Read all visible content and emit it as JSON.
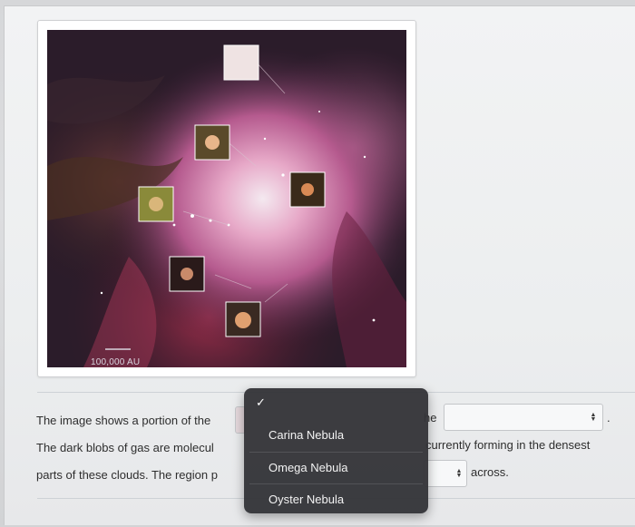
{
  "figure": {
    "scale_bar_label": "100,000 AU"
  },
  "question": {
    "line1_start": "The image shows a portion of the",
    "line1_end": "he",
    "line1_period": ".",
    "line2_start": "The dark blobs of gas are molecul",
    "line2_end": "currently forming in the densest",
    "line3_start": "parts of these clouds. The region p",
    "line3_end": "across."
  },
  "dropdown": {
    "selected_mark": "✓",
    "options": [
      "Carina Nebula",
      "Omega Nebula",
      "Oyster Nebula"
    ]
  },
  "icons": {
    "select_arrows": "up-down-arrows-icon",
    "check": "checkmark-icon"
  },
  "colors": {
    "dropdown_bg": "#343438",
    "page_bg": "#eceeef"
  }
}
